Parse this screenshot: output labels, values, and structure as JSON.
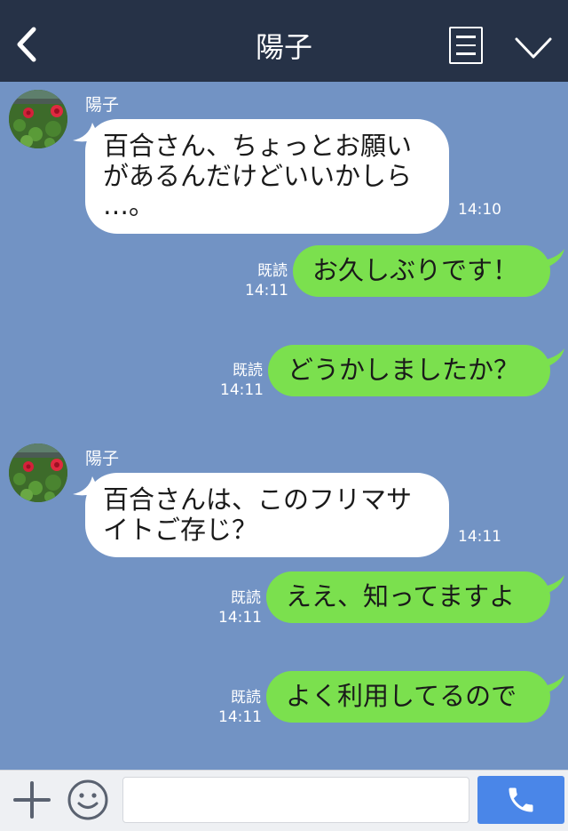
{
  "header": {
    "title": "陽子",
    "back_icon": "chevron-left-icon",
    "menu_icon": "notes-icon",
    "more_icon": "chevron-down-icon"
  },
  "colors": {
    "header_bg": "#263247",
    "chat_bg": "#7293c4",
    "incoming_bubble": "#ffffff",
    "outgoing_bubble": "#7be04e",
    "call_button": "#4a86e8"
  },
  "messages": [
    {
      "direction": "in",
      "sender": "陽子",
      "lines": [
        "百合さん、ちょっとお願い",
        "があるんだけどいいかしら",
        "…。"
      ],
      "time": "14:10"
    },
    {
      "direction": "out",
      "text": "お久しぶりです！",
      "read": "既読",
      "time": "14:11"
    },
    {
      "direction": "out",
      "text": "どうかしましたか？",
      "read": "既読",
      "time": "14:11"
    },
    {
      "direction": "in",
      "sender": "陽子",
      "lines": [
        "百合さんは、このフリマサ",
        "イトご存じ？"
      ],
      "time": "14:11"
    },
    {
      "direction": "out",
      "text": "ええ、知ってますよ",
      "read": "既読",
      "time": "14:11"
    },
    {
      "direction": "out",
      "text": "よく利用してるので",
      "read": "既読",
      "time": "14:11"
    }
  ],
  "input_bar": {
    "plus_icon": "plus-icon",
    "emoji_icon": "smiley-icon",
    "input_value": "",
    "input_placeholder": "",
    "call_icon": "phone-icon"
  }
}
